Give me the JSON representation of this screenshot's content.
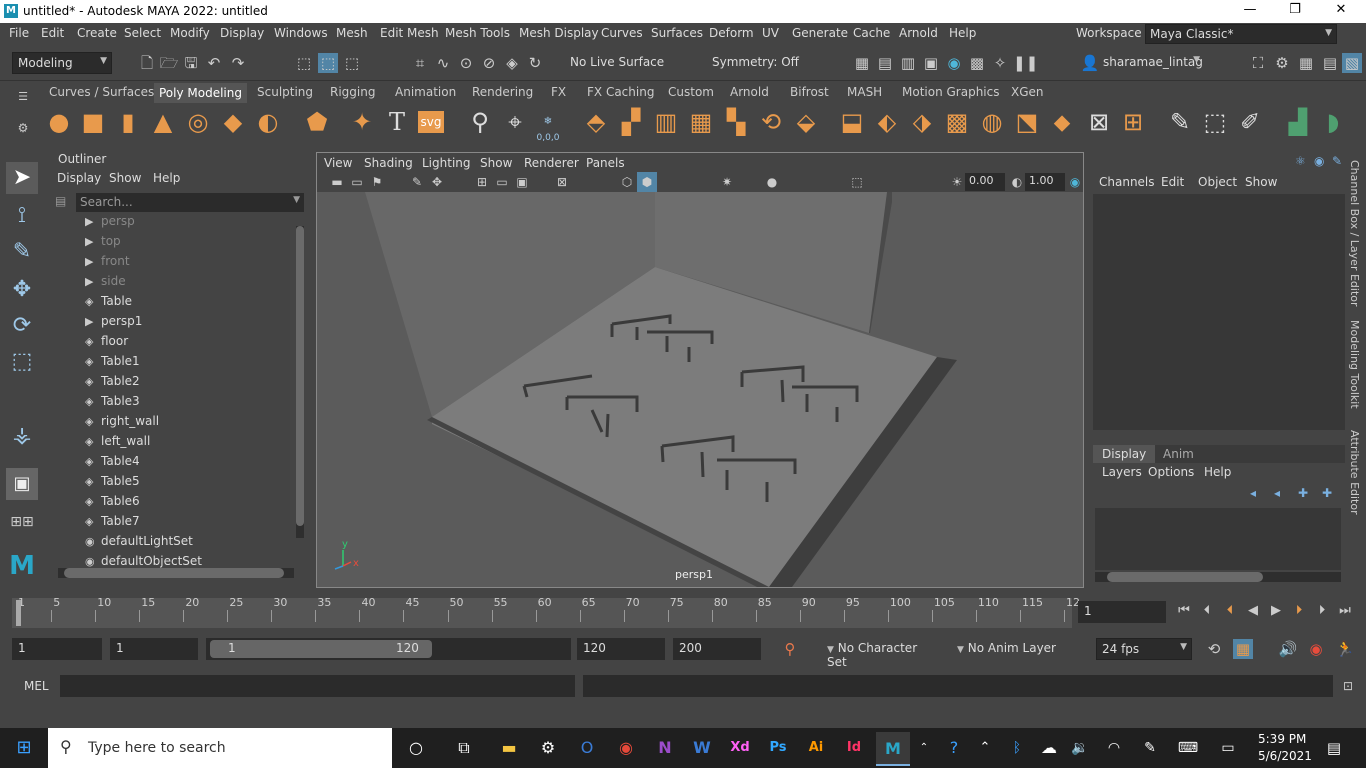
{
  "titlebar": {
    "title": "untitled* - Autodesk MAYA 2022: untitled",
    "logo": "M"
  },
  "menu": [
    "File",
    "Edit",
    "Create",
    "Select",
    "Modify",
    "Display",
    "Windows",
    "Mesh",
    "Edit Mesh",
    "Mesh Tools",
    "Mesh Display",
    "Curves",
    "Surfaces",
    "Deform",
    "UV",
    "Generate",
    "Cache",
    "Arnold",
    "Help"
  ],
  "workspace": {
    "label": "Workspace :",
    "value": "Maya Classic*"
  },
  "status": {
    "mode": "Modeling",
    "live_surface": "No Live Surface",
    "symmetry": "Symmetry: Off",
    "user": "sharamae_lintag"
  },
  "shelf_tabs": [
    "Curves / Surfaces",
    "Poly Modeling",
    "Sculpting",
    "Rigging",
    "Animation",
    "Rendering",
    "FX",
    "FX Caching",
    "Custom",
    "Arnold",
    "Bifrost",
    "MASH",
    "Motion Graphics",
    "XGen"
  ],
  "shelf_active": "Poly Modeling",
  "shelf_svg": "svg",
  "shelf_numbers": "0,0,0",
  "outliner": {
    "title": "Outliner",
    "menu": [
      "Display",
      "Show",
      "Help"
    ],
    "search_placeholder": "Search...",
    "items": [
      {
        "name": "persp",
        "icon": "camera-icon",
        "dim": true
      },
      {
        "name": "top",
        "icon": "camera-icon",
        "dim": true
      },
      {
        "name": "front",
        "icon": "camera-icon",
        "dim": true
      },
      {
        "name": "side",
        "icon": "camera-icon",
        "dim": true
      },
      {
        "name": "Table",
        "icon": "transform-icon",
        "dim": false
      },
      {
        "name": "persp1",
        "icon": "camera-icon",
        "dim": false
      },
      {
        "name": "floor",
        "icon": "transform-icon",
        "dim": false
      },
      {
        "name": "Table1",
        "icon": "transform-icon",
        "dim": false
      },
      {
        "name": "Table2",
        "icon": "transform-icon",
        "dim": false
      },
      {
        "name": "Table3",
        "icon": "transform-icon",
        "dim": false
      },
      {
        "name": "right_wall",
        "icon": "transform-icon",
        "dim": false
      },
      {
        "name": "left_wall",
        "icon": "transform-icon",
        "dim": false
      },
      {
        "name": "Table4",
        "icon": "transform-icon",
        "dim": false
      },
      {
        "name": "Table5",
        "icon": "transform-icon",
        "dim": false
      },
      {
        "name": "Table6",
        "icon": "transform-icon",
        "dim": false
      },
      {
        "name": "Table7",
        "icon": "transform-icon",
        "dim": false
      },
      {
        "name": "defaultLightSet",
        "icon": "set-icon",
        "dim": false
      },
      {
        "name": "defaultObjectSet",
        "icon": "set-icon",
        "dim": false
      }
    ]
  },
  "viewport": {
    "menu": [
      "View",
      "Shading",
      "Lighting",
      "Show",
      "Renderer",
      "Panels"
    ],
    "field1": "0.00",
    "field2": "1.00",
    "camera_label": "persp1",
    "axis_y": "y",
    "axis_x": "x"
  },
  "channelbox": {
    "menu": [
      "Channels",
      "Edit",
      "Object",
      "Show"
    ]
  },
  "layereditor": {
    "tabs": [
      "Display",
      "Anim"
    ],
    "menu": [
      "Layers",
      "Options",
      "Help"
    ]
  },
  "side_tabs": [
    "Channel Box / Layer Editor",
    "Modeling Toolkit",
    "Attribute Editor"
  ],
  "timeline": {
    "ticks": [
      "1",
      "5",
      "10",
      "15",
      "20",
      "25",
      "30",
      "35",
      "40",
      "45",
      "50",
      "55",
      "60",
      "65",
      "70",
      "75",
      "80",
      "85",
      "90",
      "95",
      "100",
      "105",
      "110",
      "115",
      "12"
    ],
    "current": "1"
  },
  "range": {
    "start": "1",
    "anim_start": "1",
    "slider_start": "1",
    "slider_end": "120",
    "end": "120",
    "anim_end": "200",
    "char_set": "No Character Set",
    "anim_layer": "No Anim Layer",
    "fps": "24 fps"
  },
  "cmd": {
    "label": "MEL"
  },
  "taskbar": {
    "search": "Type here to search",
    "time": "5:39 PM",
    "date": "5/6/2021"
  }
}
